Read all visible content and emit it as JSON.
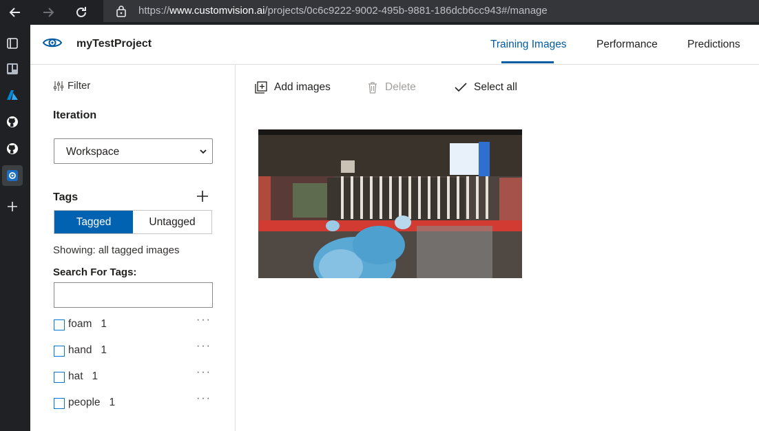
{
  "browser": {
    "url_prefix": "https://",
    "url_host": "www.customvision.ai",
    "url_path": "/projects/0c6c9222-9002-495b-9881-186dcb6cc943#/manage",
    "back_icon": "arrow-left-icon",
    "forward_icon": "arrow-right-icon",
    "refresh_icon": "refresh-icon",
    "lock_icon": "lock-icon"
  },
  "rail": {
    "icons": [
      "tab-actions-icon",
      "trello-icon",
      "azure-icon",
      "github-icon",
      "github-icon",
      "custom-vision-icon",
      "add-icon"
    ]
  },
  "header": {
    "project_name": "myTestProject",
    "tabs": [
      {
        "label": "Training Images",
        "active": true
      },
      {
        "label": "Performance",
        "active": false
      },
      {
        "label": "Predictions",
        "active": false
      }
    ],
    "accent_color": "#005ba1"
  },
  "left_panel": {
    "filter_label": "Filter",
    "iteration_heading": "Iteration",
    "iteration_value": "Workspace",
    "tags_heading": "Tags",
    "toggle": {
      "tagged": "Tagged",
      "untagged": "Untagged",
      "selected": "Tagged"
    },
    "showing_text": "Showing: all tagged images",
    "search_label": "Search For Tags:",
    "search_value": "",
    "tags": [
      {
        "name": "foam",
        "count": "1",
        "checked": false
      },
      {
        "name": "hand",
        "count": "1",
        "checked": false
      },
      {
        "name": "hat",
        "count": "1",
        "checked": false
      },
      {
        "name": "people",
        "count": "1",
        "checked": false
      }
    ],
    "more_label": "···"
  },
  "toolbar": {
    "add_label": "Add images",
    "delete_label": "Delete",
    "select_all_label": "Select all"
  },
  "images": [
    {
      "alt": "camera frame of a person in blue protective clothing working at a red rack"
    }
  ]
}
